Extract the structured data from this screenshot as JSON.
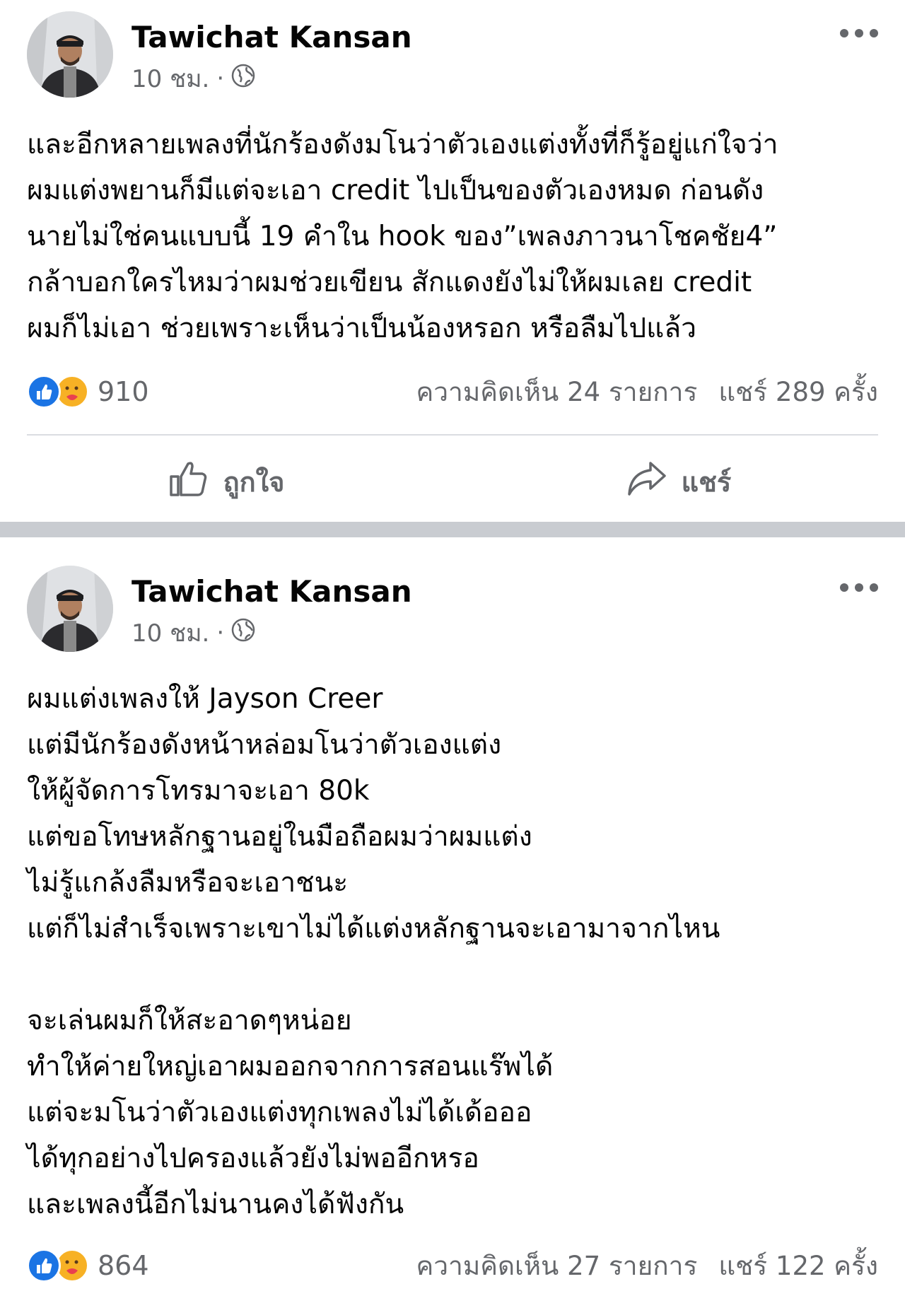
{
  "posts": [
    {
      "author": "Tawichat Kansan",
      "time": "10 ชม.",
      "separator": "·",
      "privacy_icon": "globe-icon",
      "lines": [
        "และอีกหลายเพลงที่นักร้องดังมโนว่าตัวเองแต่งทั้งที่ก็รู้อยู่แก่ใจว่า",
        "ผมแต่งพยานก็มีแต่จะเอา credit ไปเป็นของตัวเองหมด ก่อนดัง",
        "นายไม่ใช่คนแบบนี้  19 คำใน hook ของ”เพลงภาวนาโชคชัย4”",
        "กล้าบอกใครไหมว่าผมช่วยเขียน สักแดงยังไม่ให้ผมเลย credit",
        "ผมก็ไม่เอา ช่วยเพราะเห็นว่าเป็นน้องหรอก หรือลืมไปแล้ว"
      ],
      "reaction_count": "910",
      "comments": "ความคิดเห็น 24 รายการ",
      "shares": "แชร์ 289 ครั้ง",
      "like_label": "ถูกใจ",
      "share_label": "แชร์"
    },
    {
      "author": "Tawichat Kansan",
      "time": "10 ชม.",
      "separator": "·",
      "privacy_icon": "globe-icon",
      "lines": [
        "ผมแต่งเพลงให้ Jayson Creer",
        "แต่มีนักร้องดังหน้าหล่อมโนว่าตัวเองแต่ง",
        "ให้ผู้จัดการโทรมาจะเอา 80k",
        "แต่ขอโทษหลักฐานอยู่ในมือถือผมว่าผมแต่ง",
        "ไม่รู้แกล้งลืมหรือจะเอาชนะ",
        "แต่ก็ไม่สำเร็จเพราะเขาไม่ได้แต่งหลักฐานจะเอามาจากไหน",
        "",
        "จะเล่นผมก็ให้สะอาดๆหน่อย",
        "ทำให้ค่ายใหญ่เอาผมออกจากการสอนแร๊พได้",
        "แต่จะมโนว่าตัวเองแต่งทุกเพลงไม่ได้เด้อออ",
        "ได้ทุกอย่างไปครองแล้วยังไม่พออีกหรอ",
        "และเพลงนี้อีกไม่นานคงได้ฟังกัน"
      ],
      "reaction_count": "864",
      "comments": "ความคิดเห็น 27 รายการ",
      "shares": "แชร์ 122 ครั้ง"
    }
  ],
  "colors": {
    "like_blue": "#1b74e4",
    "care_yellow": "#f7b125",
    "secondary_text": "#65676b",
    "separator_band": "#c9ccd1"
  }
}
